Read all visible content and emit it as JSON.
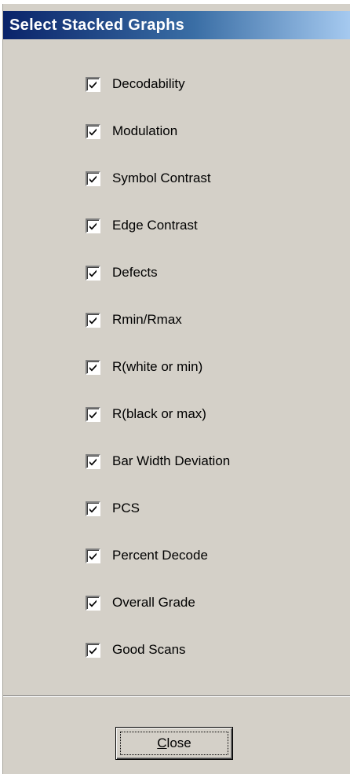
{
  "dialog": {
    "title": "Select Stacked Graphs"
  },
  "options": [
    {
      "label": "Decodability",
      "checked": true
    },
    {
      "label": "Modulation",
      "checked": true
    },
    {
      "label": "Symbol Contrast",
      "checked": true
    },
    {
      "label": "Edge Contrast",
      "checked": true
    },
    {
      "label": "Defects",
      "checked": true
    },
    {
      "label": "Rmin/Rmax",
      "checked": true
    },
    {
      "label": "R(white or min)",
      "checked": true
    },
    {
      "label": "R(black or max)",
      "checked": true
    },
    {
      "label": "Bar Width Deviation",
      "checked": true
    },
    {
      "label": "PCS",
      "checked": true
    },
    {
      "label": "Percent Decode",
      "checked": true
    },
    {
      "label": "Overall Grade",
      "checked": true
    },
    {
      "label": "Good Scans",
      "checked": true
    }
  ],
  "footer": {
    "close_mnemonic": "C",
    "close_rest": "lose"
  },
  "colors": {
    "title_gradient_start": "#0a246a",
    "title_gradient_end": "#a6caf0",
    "dialog_background": "#d4d0c8"
  },
  "icons": {
    "checkbox_mark": "check-mark-icon"
  }
}
